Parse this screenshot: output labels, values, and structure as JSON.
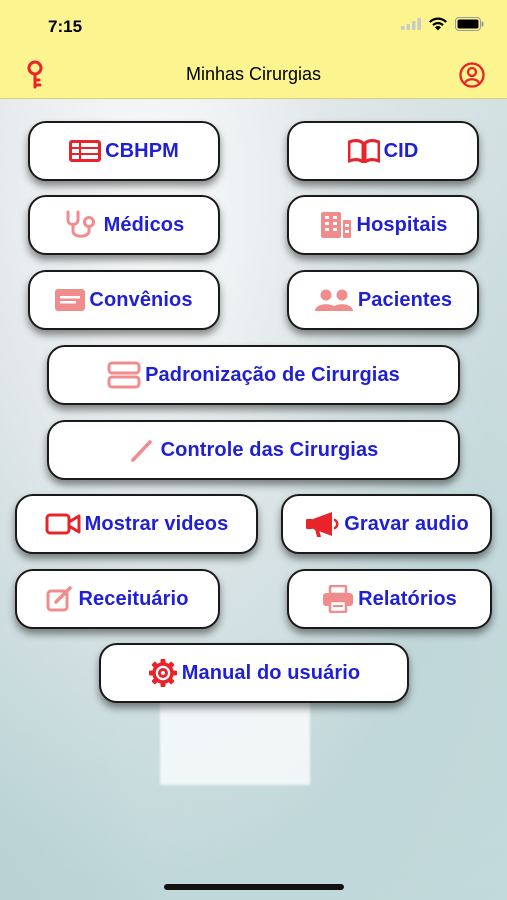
{
  "status": {
    "time": "7:15"
  },
  "nav": {
    "title": "Minhas Cirurgias"
  },
  "buttons": {
    "cbhpm": "CBHPM",
    "cid": "CID",
    "medicos": "Médicos",
    "hospitais": "Hospitais",
    "convenios": "Convênios",
    "pacientes": "Pacientes",
    "padronizacao": "Padronização de Cirurgias",
    "controle": "Controle das Cirurgias",
    "videos": "Mostrar videos",
    "audio": "Gravar audio",
    "receituario": "Receituário",
    "relatorios": "Relatórios",
    "manual": "Manual do usuário"
  },
  "colors": {
    "header_bg": "#fbf48f",
    "label": "#1f1fd6",
    "icon_red": "#e8242a",
    "icon_pink": "#f08c8c"
  }
}
